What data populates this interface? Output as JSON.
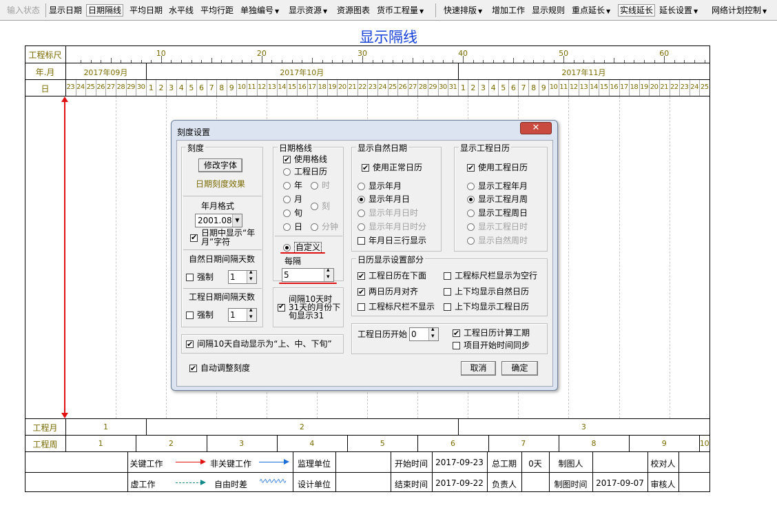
{
  "toolbar": {
    "items": [
      {
        "label": "输入状态",
        "disabled": true
      },
      {
        "label": "显示日期"
      },
      {
        "label": "日期隔线",
        "active": true
      },
      {
        "label": "平均日期"
      },
      {
        "label": "水平线"
      },
      {
        "label": "平均行距"
      },
      {
        "label": "单独编号",
        "dropdown": true
      },
      {
        "label": "显示资源",
        "dropdown": true
      },
      {
        "label": "资源图表"
      },
      {
        "label": "货币工程量",
        "dropdown": true
      },
      {
        "label": "快速排版",
        "dropdown": true
      },
      {
        "label": "增加工作"
      },
      {
        "label": "显示规则"
      },
      {
        "label": "重点延长",
        "dropdown": true
      },
      {
        "label": "实线延长"
      },
      {
        "label": "延长设置",
        "dropdown": true
      },
      {
        "label": "网络计划控制",
        "dropdown": true
      }
    ]
  },
  "page": {
    "title": "显示隔线"
  },
  "timeline": {
    "row_labels": {
      "ruler": "工程标尺",
      "month": "年.月",
      "day": "日",
      "eng_month": "工程月",
      "eng_week": "工程周"
    },
    "ruler_ticks": [
      "10",
      "20",
      "30",
      "40",
      "50",
      "60"
    ],
    "months": [
      "2017年09月",
      "2017年10月",
      "2017年11月"
    ],
    "days": [
      "23",
      "24",
      "25",
      "26",
      "27",
      "28",
      "29",
      "30",
      "1",
      "2",
      "3",
      "4",
      "5",
      "6",
      "7",
      "8",
      "9",
      "10",
      "11",
      "12",
      "13",
      "14",
      "15",
      "16",
      "17",
      "18",
      "19",
      "20",
      "21",
      "22",
      "23",
      "24",
      "25",
      "26",
      "27",
      "28",
      "29",
      "30",
      "31",
      "1",
      "2",
      "3",
      "4",
      "5",
      "6",
      "7",
      "8",
      "9",
      "10",
      "11",
      "12",
      "13",
      "14",
      "15",
      "16",
      "17",
      "18",
      "19",
      "20",
      "21",
      "22",
      "23",
      "24",
      "25"
    ],
    "eng_months": [
      "1",
      "2",
      "3"
    ],
    "eng_weeks": [
      "1",
      "2",
      "3",
      "4",
      "5",
      "6",
      "7",
      "8",
      "9",
      "10"
    ]
  },
  "legend": {
    "critical": "关键工作",
    "noncritical": "非关键工作",
    "supervisor": "监理单位",
    "start_time_label": "开始时间",
    "start_time": "2017-09-23",
    "total_label": "总工期",
    "total": "0天",
    "maker_label": "制图人",
    "checker_label": "校对人",
    "dummy": "虚工作",
    "float": "自由时差",
    "designer": "设计单位",
    "end_time_label": "结束时间",
    "end_time": "2017-09-22",
    "owner_label": "负责人",
    "made_time_label": "制图时间",
    "made_time": "2017-09-07",
    "auditor_label": "审核人"
  },
  "dialog": {
    "title": "刻度设置",
    "close": "✕",
    "scale": {
      "title": "刻度",
      "font_button": "修改字体",
      "effect": "日期刻度效果",
      "format_label": "年月格式",
      "format_value": "2001.08",
      "show_ym_text": "日期中显示“年月”字符",
      "natural_interval_label": "自然日期间隔天数",
      "force": "强制",
      "natural_interval": "1",
      "eng_interval_label": "工程日期间隔天数",
      "eng_interval": "1"
    },
    "grid": {
      "title": "日期格线",
      "use_grid": "使用格线",
      "eng_cal": "工程日历",
      "year": "年",
      "hour": "时",
      "month": "月",
      "quarter": "刻",
      "xun": "旬",
      "day": "日",
      "minute": "分钟",
      "custom": "自定义",
      "every_label": "每隔",
      "every_value": "5",
      "interval31": "间隔10天时31天的月份下旬显示31"
    },
    "natural": {
      "title": "显示自然日期",
      "use_normal": "使用正常日历",
      "show_ym": "显示年月",
      "show_ymd": "显示年月日",
      "show_ymdh": "显示年月日时",
      "show_ymdhm": "显示年月日时分",
      "three_rows": "年月日三行显示"
    },
    "eng": {
      "title": "显示工程日历",
      "use_eng": "使用工程日历",
      "show_eng_ym": "显示工程年月",
      "show_eng_yw": "显示工程月周",
      "show_eng_wd": "显示工程周日",
      "show_eng_dh": "显示工程日时",
      "show_nat_wh": "显示自然周时"
    },
    "calendar": {
      "title": "日历显示设置部分",
      "eng_below": "工程日历在下面",
      "ruler_blank": "工程标尺栏显示为空行",
      "two_align": "两日历月对齐",
      "both_natural": "上下均显示自然日历",
      "ruler_hide": "工程标尺栏不显示",
      "both_eng": "上下均显示工程日历"
    },
    "eng_start_label": "工程日历开始",
    "eng_start_value": "0",
    "calc_period": "工程日历计算工期",
    "sync_start": "项目开始时间同步",
    "xun_auto": "间隔10天自动显示为“上、中、下旬”",
    "auto_adjust": "自动调整刻度",
    "cancel": "取消",
    "ok": "确定"
  }
}
